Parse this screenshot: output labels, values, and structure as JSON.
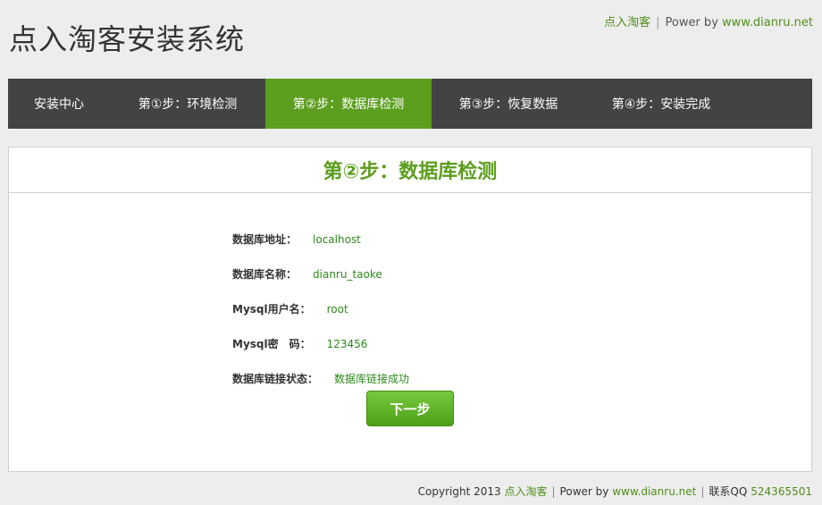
{
  "header": {
    "title": "点入淘客安装系统",
    "top_link_name": "点入淘客",
    "top_separator": "|",
    "power_label": "Power by",
    "power_url": "www.dianru.net"
  },
  "nav": {
    "items": [
      {
        "label": "安装中心"
      },
      {
        "label": "第①步：环境检测"
      },
      {
        "label": "第②步：数据库检测"
      },
      {
        "label": "第③步：恢复数据"
      },
      {
        "label": "第④步：安装完成"
      }
    ],
    "active_index": 2
  },
  "panel": {
    "title": "第②步：数据库检测",
    "rows": [
      {
        "label": "数据库地址：",
        "value": "localhost"
      },
      {
        "label": "数据库名称：",
        "value": "dianru_taoke"
      },
      {
        "label": "Mysql用户名：",
        "value": "root"
      },
      {
        "label": "Mysql密　码：",
        "value": "123456"
      },
      {
        "label": "数据库链接状态：",
        "value": "数据库链接成功"
      }
    ],
    "next_button": "下一步"
  },
  "footer": {
    "copyright": "Copyright 2013",
    "brand": "点入淘客",
    "separator": "|",
    "power_label": "Power by",
    "power_url": "www.dianru.net",
    "qq_label": "联系QQ",
    "qq_number": "524365501"
  },
  "colors": {
    "accent": "#5c9e1d",
    "nav_bg": "#434343",
    "page_bg": "#ededed"
  }
}
